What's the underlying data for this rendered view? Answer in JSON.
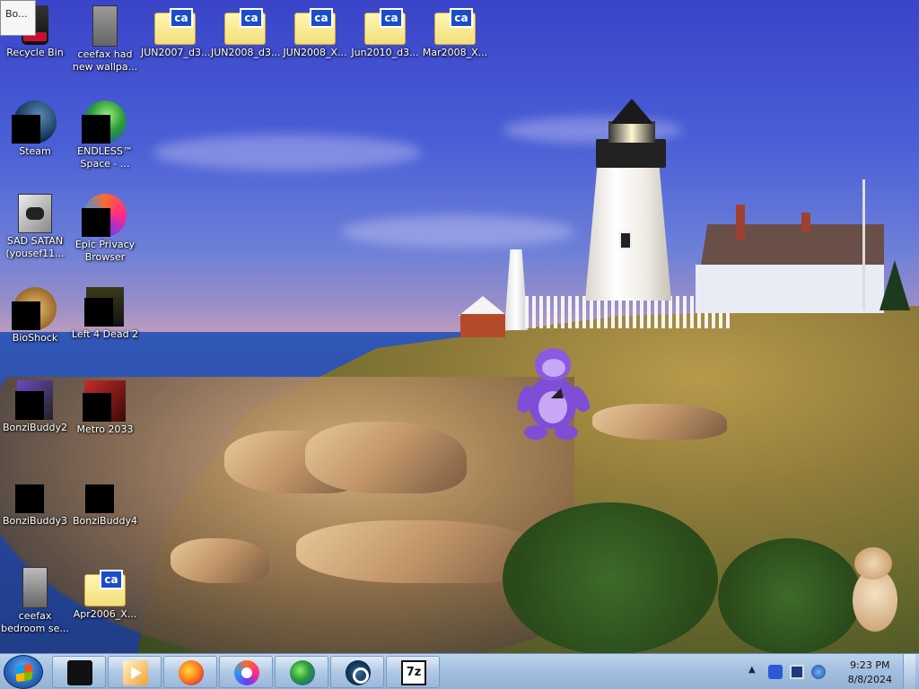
{
  "tooltip": {
    "text": "Bo..."
  },
  "desktop_icons": [
    {
      "label": "Recycle Bin",
      "icon": "recycle-bin-icon"
    },
    {
      "label": "ceefax had new wallpa...",
      "icon": "ceefax-image-icon"
    },
    {
      "label": "JUN2007_d3...",
      "icon": "ca-folder-icon"
    },
    {
      "label": "JUN2008_d3...",
      "icon": "ca-folder-icon"
    },
    {
      "label": "JUN2008_X...",
      "icon": "ca-folder-icon"
    },
    {
      "label": "Jun2010_d3...",
      "icon": "ca-folder-icon"
    },
    {
      "label": "Mar2008_X...",
      "icon": "ca-folder-icon"
    },
    {
      "label": "Steam",
      "icon": "steam-icon"
    },
    {
      "label": "ENDLESS™ Space - ...",
      "icon": "endless-space-icon"
    },
    {
      "label": "SAD SATAN (yousef11...",
      "icon": "sad-satan-icon"
    },
    {
      "label": "Epic Privacy Browser",
      "icon": "epic-browser-icon"
    },
    {
      "label": "BioShock",
      "icon": "bioshock-icon"
    },
    {
      "label": "Left 4 Dead 2",
      "icon": "left4dead2-icon"
    },
    {
      "label": "BonziBuddy2",
      "icon": "bonzibuddy-icon"
    },
    {
      "label": "Metro 2033",
      "icon": "metro2033-icon"
    },
    {
      "label": "BonziBuddy3",
      "icon": "bonzibuddy-icon"
    },
    {
      "label": "BonziBuddy4",
      "icon": "bonzibuddy-icon"
    },
    {
      "label": "ceefax bedroom se...",
      "icon": "ceefax-image-icon"
    },
    {
      "label": "Apr2006_X...",
      "icon": "ca-folder-icon"
    }
  ],
  "folder_badge": "ca",
  "taskbar": {
    "pinned": [
      {
        "name": "unknown-black-app",
        "icon": "black-box-icon"
      },
      {
        "name": "media-player",
        "icon": "media-player-icon"
      },
      {
        "name": "firefox",
        "icon": "firefox-icon"
      },
      {
        "name": "epic-privacy-browser",
        "icon": "epic-browser-icon"
      },
      {
        "name": "internet-download-manager",
        "icon": "download-manager-icon"
      },
      {
        "name": "steam",
        "icon": "steam-icon"
      },
      {
        "name": "7-zip",
        "icon": "7zip-icon",
        "text": "7z"
      }
    ],
    "clock": {
      "time": "9:23 PM",
      "date": "8/8/2024"
    },
    "tray_icons": [
      "show-hidden-icons",
      "bluetooth-icon",
      "display-icon",
      "network-icon"
    ]
  },
  "colors": {
    "taskbar": "#a4c0e0",
    "folder": "#f4de7a",
    "ca_badge": "#1a4ec8",
    "bonzi": "#7e4ed6"
  }
}
